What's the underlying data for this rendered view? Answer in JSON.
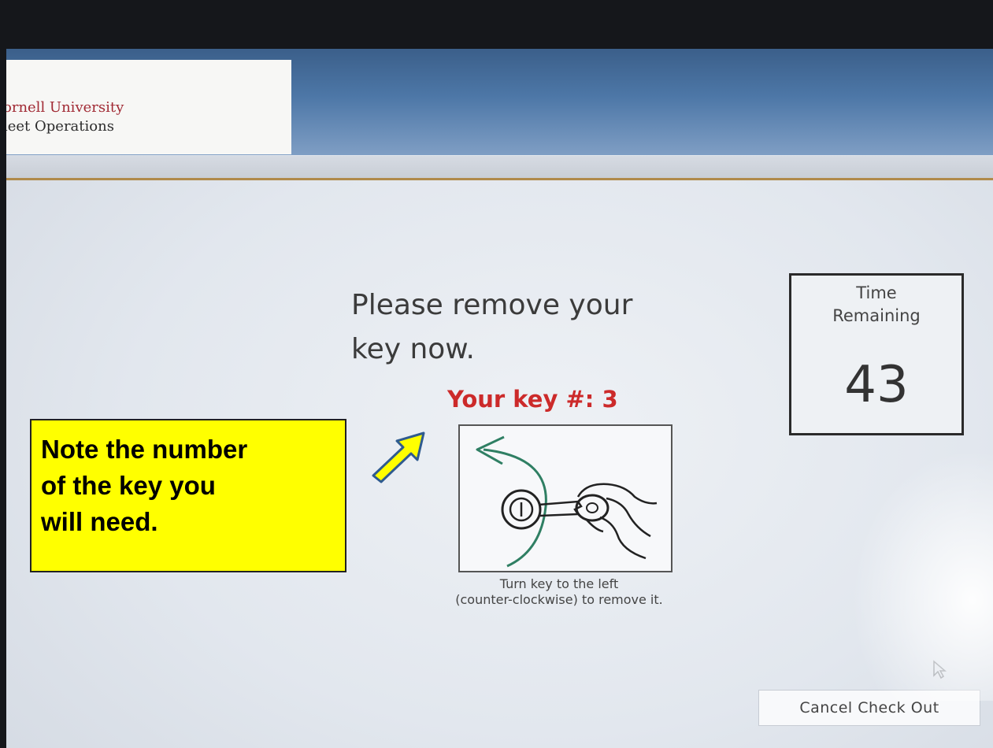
{
  "header": {
    "logo_line1": "ornell University",
    "logo_line2": "leet Operations"
  },
  "main": {
    "prompt_line1": "Please remove your",
    "prompt_line2": "key now.",
    "key_number": "Your key #: 3",
    "caption_line1": "Turn key to the left",
    "caption_line2": "(counter-clockwise) to remove it."
  },
  "timer": {
    "label_line1": "Time",
    "label_line2": "Remaining",
    "value": "43"
  },
  "footer": {
    "cancel_label": "Cancel Check Out"
  },
  "callout": {
    "line1": "Note the number",
    "line2": "of the key you",
    "line3": "will need.",
    "background": "#ffff00"
  },
  "colors": {
    "key_number": "#cc2a2a",
    "header_blue": "#4d77a7",
    "rule_gold": "#b08a4a"
  },
  "icons": {
    "arrow": "pointer-arrow-icon",
    "key_turn": "key-turn-left-illustration",
    "cursor": "mouse-cursor-icon"
  }
}
